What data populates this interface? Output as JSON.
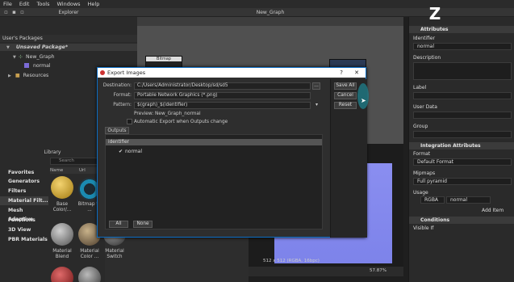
{
  "menu": [
    "File",
    "Edit",
    "Tools",
    "Windows",
    "Help"
  ],
  "explorer": {
    "title": "Explorer",
    "header": "User's Packages",
    "package": "Unsaved Package*",
    "graph": "New_Graph",
    "item_normal": "normal",
    "resources": "Resources"
  },
  "graph_tab": "New_Graph",
  "graph_node_label": "Bitmap",
  "library": {
    "title": "Library",
    "search_placeholder": "Search",
    "col_name": "Name",
    "col_url": "Url",
    "categories": [
      "Favorites",
      "Generators",
      "Filters",
      "Material Filt...",
      "Mesh Adaptive",
      "Functions",
      "3D View",
      "PBR Materials"
    ],
    "thumbs": [
      "Base Color/...",
      "Bitmap to ...",
      "Material Blend",
      "Material Color ...",
      "Material Switch"
    ]
  },
  "attributes": {
    "title": "Attributes",
    "identifier_label": "Identifier",
    "identifier_value": "normal",
    "description_label": "Description",
    "label_label": "Label",
    "user_data_label": "User Data",
    "group_label": "Group",
    "integration_title": "Integration Attributes",
    "format_label": "Format",
    "format_value": "Default Format",
    "mipmaps_label": "Mipmaps",
    "mipmaps_value": "Full pyramid",
    "usage_label": "Usage",
    "usage_value1": "RGBA",
    "usage_value2": "normal",
    "add_item": "Add Item",
    "conditions_title": "Conditions",
    "visible_if_label": "Visible If"
  },
  "view2d": {
    "status_left": "512 x 512 (RGBA, 16bpc)",
    "zoom": "57.87%"
  },
  "dialog": {
    "title": "Export Images",
    "help": "?",
    "close": "✕",
    "destination_label": "Destination:",
    "destination_value": "C:/Users/Administrator/Desktop/sd/sd5",
    "format_label": "Format:",
    "format_value": "Portable Network Graphics (*.png)",
    "pattern_label": "Pattern:",
    "pattern_value": "$(graph)_$(identifier)",
    "preview_text": "Preview: New_Graph_normal",
    "auto_export": "Automatic Export when Outputs change",
    "outputs_tab": "Outputs",
    "col_identifier": "identifier",
    "output_item": "normal",
    "btn_save_all": "Save All",
    "btn_cancel": "Cancel",
    "btn_reset": "Reset",
    "btn_all": "All",
    "btn_none": "None"
  },
  "colors": {
    "accent": "#0d6ec4",
    "view_blue": "#8a8ef0",
    "highlight_teal": "#1f7a86"
  }
}
